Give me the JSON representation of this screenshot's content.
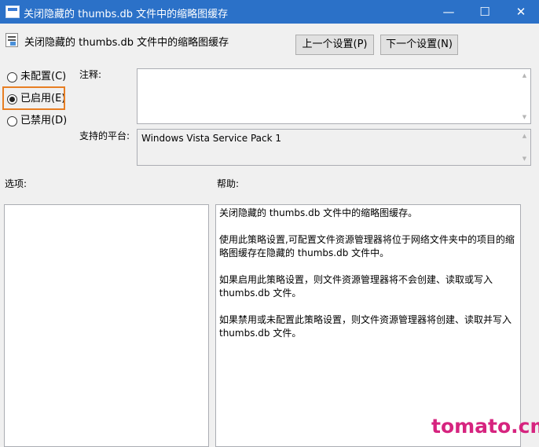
{
  "window": {
    "title": "关闭隐藏的 thumbs.db 文件中的缩略图缓存",
    "minimize_glyph": "—",
    "maximize_glyph": "☐",
    "close_glyph": "✕"
  },
  "header": {
    "policy_title": "关闭隐藏的 thumbs.db 文件中的缩略图缓存",
    "prev_button": "上一个设置(P)",
    "next_button": "下一个设置(N)"
  },
  "state": {
    "options": [
      {
        "label": "未配置(C)",
        "checked": false
      },
      {
        "label": "已启用(E)",
        "checked": true
      },
      {
        "label": "已禁用(D)",
        "checked": false
      }
    ],
    "highlight_color": "#e77e23"
  },
  "comment": {
    "label": "注释:",
    "value": ""
  },
  "platform": {
    "label": "支持的平台:",
    "value": "Windows Vista Service Pack 1"
  },
  "options_section": {
    "label": "选项:"
  },
  "help": {
    "label": "帮助:",
    "paragraphs": [
      "关闭隐藏的 thumbs.db 文件中的缩略图缓存。",
      "使用此策略设置,可配置文件资源管理器将位于网络文件夹中的项目的缩略图缓存在隐藏的 thumbs.db 文件中。",
      "如果启用此策略设置，则文件资源管理器将不会创建、读取或写入 thumbs.db 文件。",
      "如果禁用或未配置此策略设置，则文件资源管理器将创建、读取并写入 thumbs.db 文件。"
    ]
  },
  "watermark": {
    "text": "tomato.cm",
    "color": "#d6247f"
  },
  "colors": {
    "titlebar": "#2b71c8",
    "background": "#f0f0f0"
  }
}
